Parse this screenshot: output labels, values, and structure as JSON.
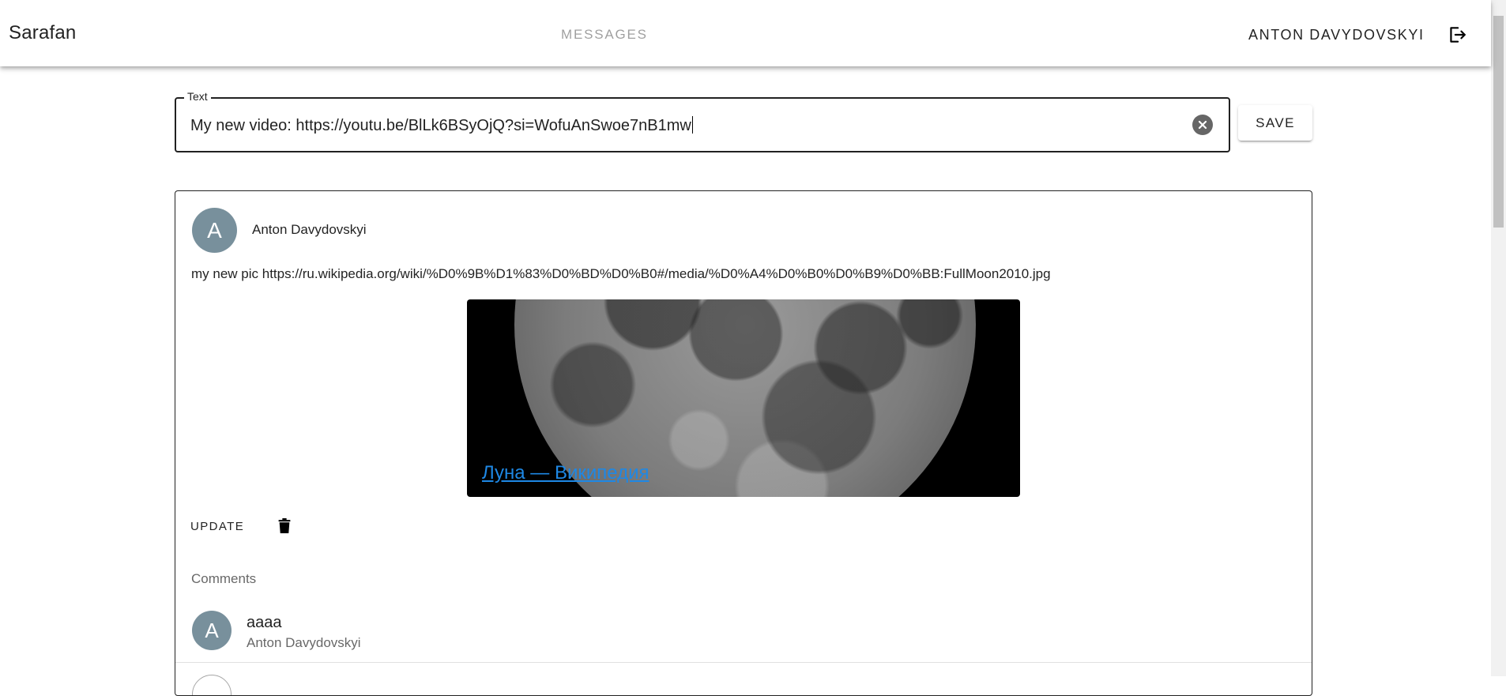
{
  "app": {
    "title": "Sarafan",
    "nav_messages": "MESSAGES",
    "user_name": "ANTON DAVYDOVSKYI",
    "logout_icon": "logout-icon"
  },
  "editor": {
    "label": "Text",
    "value": "My new video: https://youtu.be/BlLk6BSyOjQ?si=WofuAnSwoe7nB1mw",
    "clear_icon": "close-circle-icon",
    "save_label": "SAVE"
  },
  "message": {
    "avatar_letter": "A",
    "author": "Anton Davydovskyi",
    "text": "my new pic https://ru.wikipedia.org/wiki/%D0%9B%D1%83%D0%BD%D0%B0#/media/%D0%A4%D0%B0%D0%B9%D0%BB:FullMoon2010.jpg",
    "preview_link": "Луна — Википедия",
    "update_label": "UPDATE",
    "delete_icon": "trash-icon",
    "comments_title": "Comments",
    "comments": [
      {
        "avatar_letter": "A",
        "text": "aaaa",
        "author": "Anton Davydovskyi"
      }
    ]
  },
  "colors": {
    "avatar": "#78909c",
    "link": "#1e88e5"
  }
}
